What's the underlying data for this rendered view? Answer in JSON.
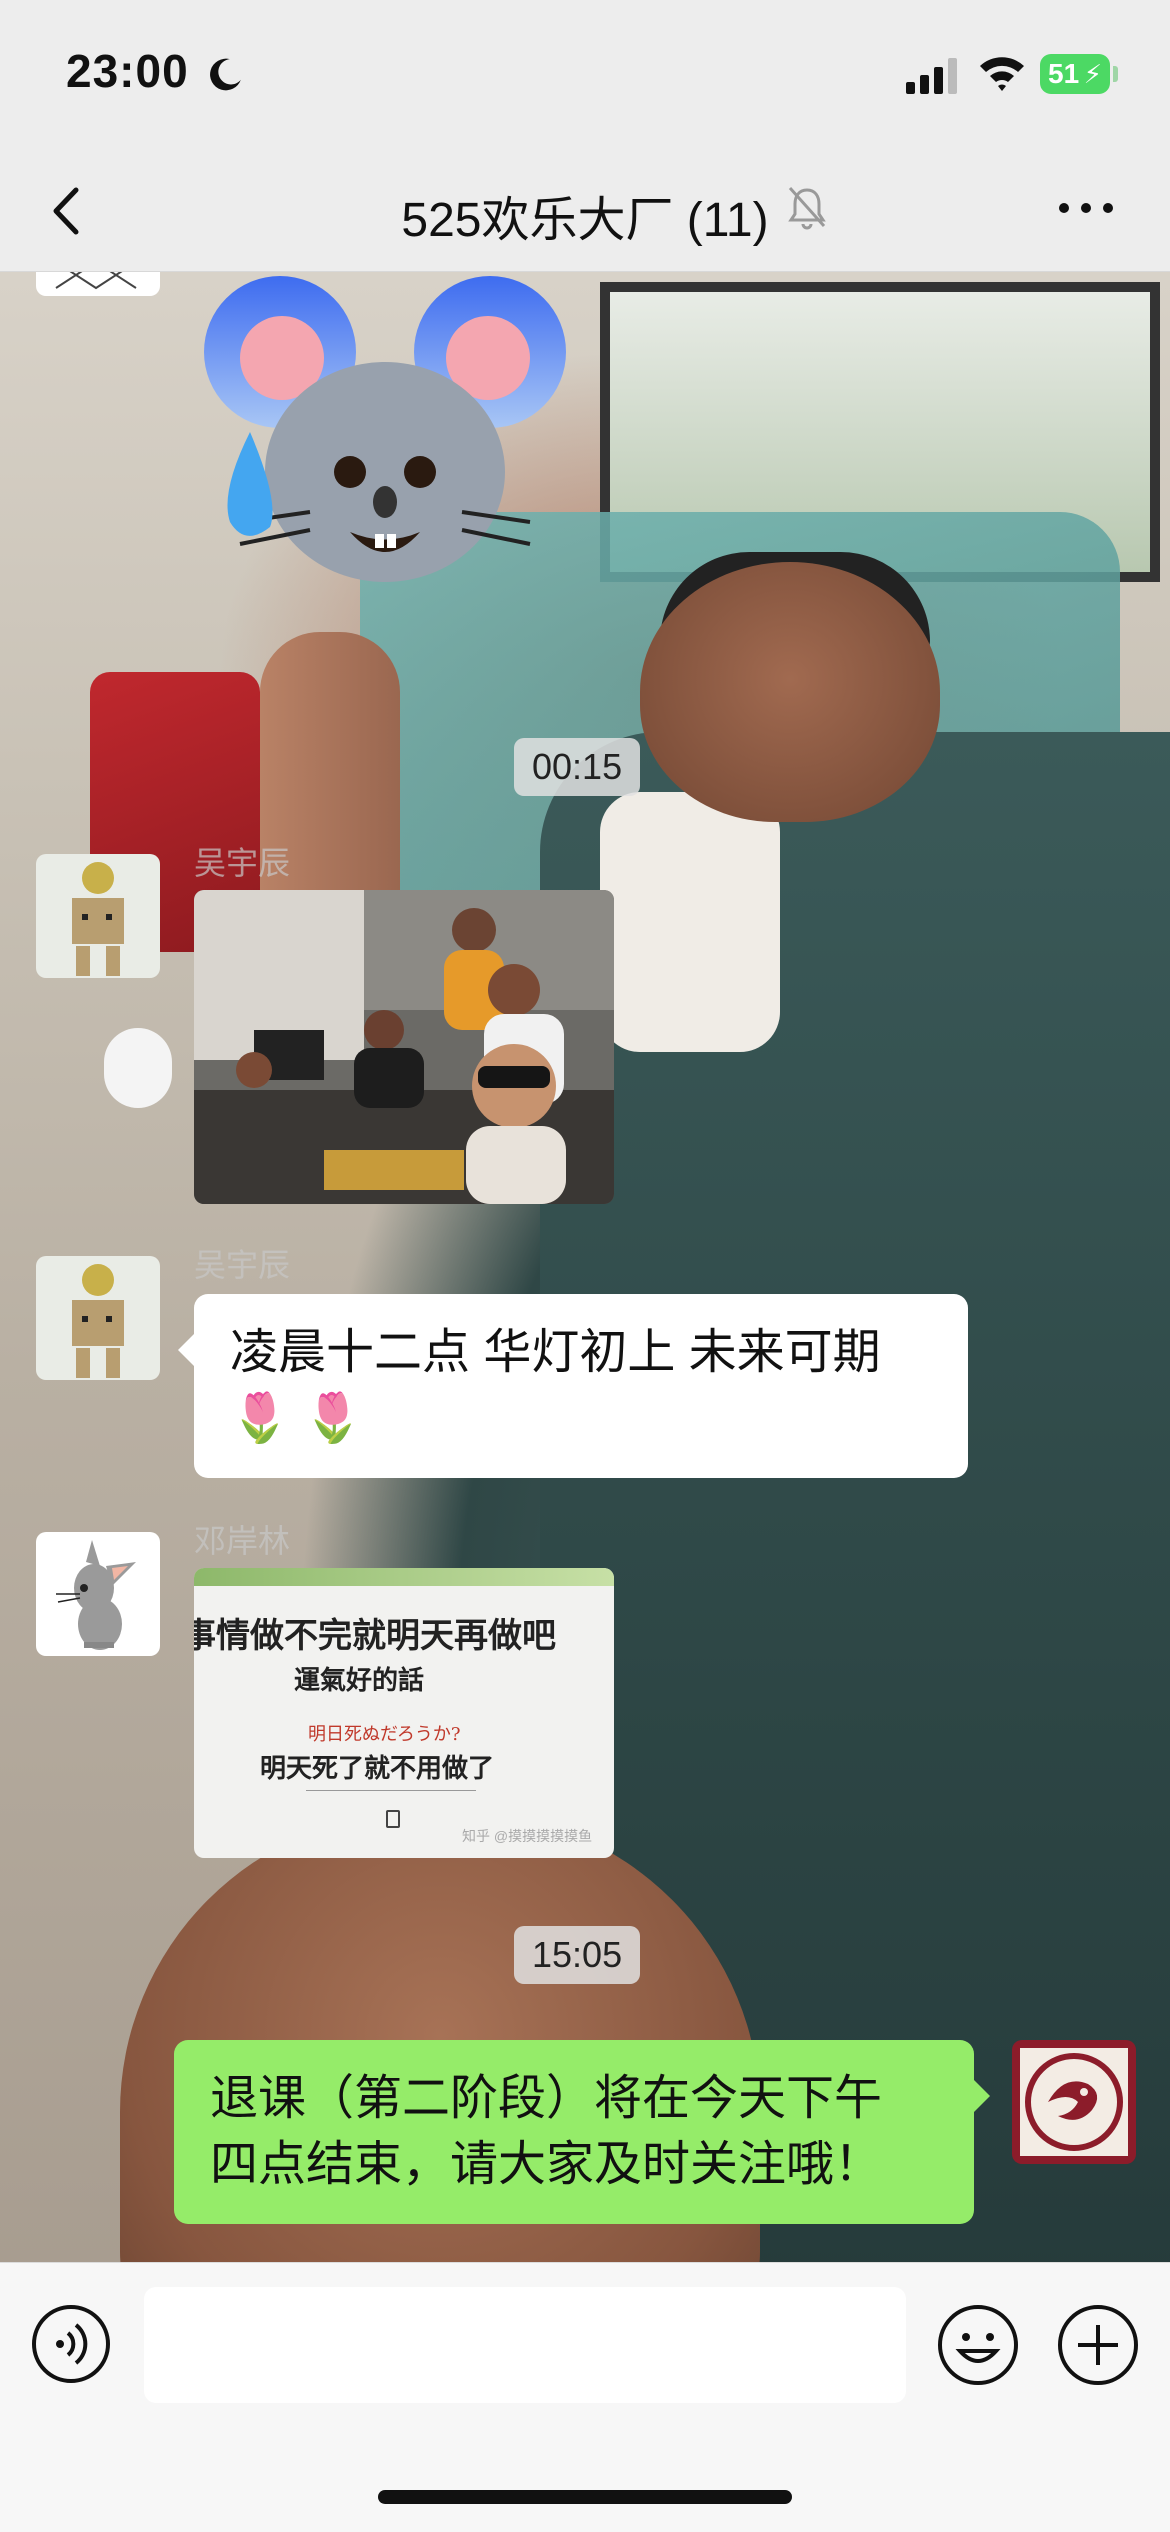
{
  "status_bar": {
    "time": "23:00",
    "battery": "51",
    "icons": [
      "moon-icon",
      "signal-icon",
      "wifi-icon",
      "battery-icon"
    ]
  },
  "header": {
    "title": "525欢乐大厂 (11)",
    "icons": [
      "back-icon",
      "mute-icon",
      "more-icon"
    ]
  },
  "messages": [
    {
      "type": "timestamp",
      "text": "00:15"
    },
    {
      "type": "image",
      "sender": "吴宇辰",
      "side": "left",
      "content": "group-selfie-photo"
    },
    {
      "type": "text",
      "sender": "吴宇辰",
      "side": "left",
      "text": "凌晨十二点 华灯初上 未来可期",
      "emoji": "🌷 🌷"
    },
    {
      "type": "image",
      "sender": "邓岸林",
      "side": "left",
      "content": "quote-poster-photo",
      "poster_lines": [
        "事情做不完就明天再做吧",
        "運氣好的話",
        "明日死ぬだろうか?",
        "明天死了就不用做了"
      ],
      "watermark": "知乎 @摸摸摸摸摸鱼"
    },
    {
      "type": "timestamp",
      "text": "15:05"
    },
    {
      "type": "text",
      "side": "right",
      "text_line1": "退课（第二阶段）将在今天下午",
      "text_line2": "四点结束，请大家及时关注哦！"
    }
  ],
  "input": {
    "value": "",
    "placeholder": ""
  },
  "colors": {
    "nav_bg": "#ededed",
    "bubble_green": "#95ec69",
    "bubble_white": "#ffffff",
    "battery": "#4cd964"
  }
}
